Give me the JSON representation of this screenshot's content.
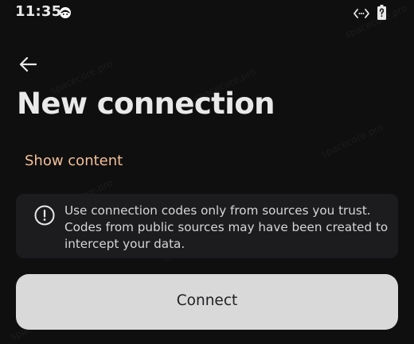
{
  "status_bar": {
    "time": "11:35",
    "app_icon": "app-face-icon",
    "connection_icon": "code-brackets-icon",
    "battery_icon": "battery-unknown-icon"
  },
  "header": {
    "back_icon": "arrow-left-icon",
    "title": "New connection"
  },
  "main": {
    "show_content_label": "Show content",
    "warning": {
      "icon": "info-circle-icon",
      "text": "Use connection codes only from sources you trust. Codes from public sources may have been created to intercept your data."
    },
    "connect_label": "Connect"
  },
  "watermark_text": "spacecore.pro",
  "colors": {
    "background": "#0f0f10",
    "link_accent": "#f2bf96",
    "warning_box_bg": "#1c1c1f",
    "button_bg": "#d9d9d9"
  }
}
